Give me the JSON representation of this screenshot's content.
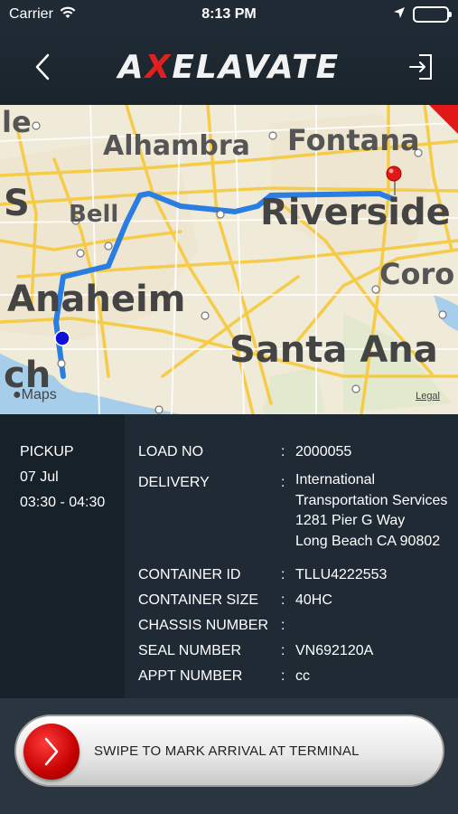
{
  "status_bar": {
    "carrier": "Carrier",
    "time": "8:13 PM"
  },
  "header": {
    "logo_prefix": "A",
    "logo_x": "X",
    "logo_suffix": "ELAVATE"
  },
  "map": {
    "labels": [
      "le",
      "Alhambra",
      "Fontana",
      "S",
      "Bell",
      "Riverside",
      "Coro",
      "Anaheim",
      "Santa Ana",
      "ch"
    ],
    "brand": "Maps",
    "legal": "Legal",
    "route_color": "#2a7de1",
    "origin_pin_color": "#1010d8",
    "destination_pin_color": "#e01818"
  },
  "pickup": {
    "title": "PICKUP",
    "date": "07 Jul",
    "time_window": "03:30 - 04:30"
  },
  "details": {
    "load_no": {
      "label": "LOAD NO",
      "value": "2000055"
    },
    "delivery": {
      "label": "DELIVERY",
      "lines": [
        "International",
        "Transportation Services",
        "1281 Pier G Way",
        "Long Beach CA 90802"
      ]
    },
    "container_id": {
      "label": "CONTAINER ID",
      "value": "TLLU4222553"
    },
    "container_size": {
      "label": "CONTAINER SIZE",
      "value": "40HC"
    },
    "chassis_number": {
      "label": "CHASSIS NUMBER",
      "value": ""
    },
    "seal_number": {
      "label": "SEAL NUMBER",
      "value": "VN692120A"
    },
    "appt_number": {
      "label": "APPT NUMBER",
      "value": "cc"
    }
  },
  "swipe": {
    "label": "SWIPE TO MARK ARRIVAL AT TERMINAL"
  },
  "colors": {
    "header_bg": "#1f2a34",
    "accent_red": "#e02020"
  }
}
